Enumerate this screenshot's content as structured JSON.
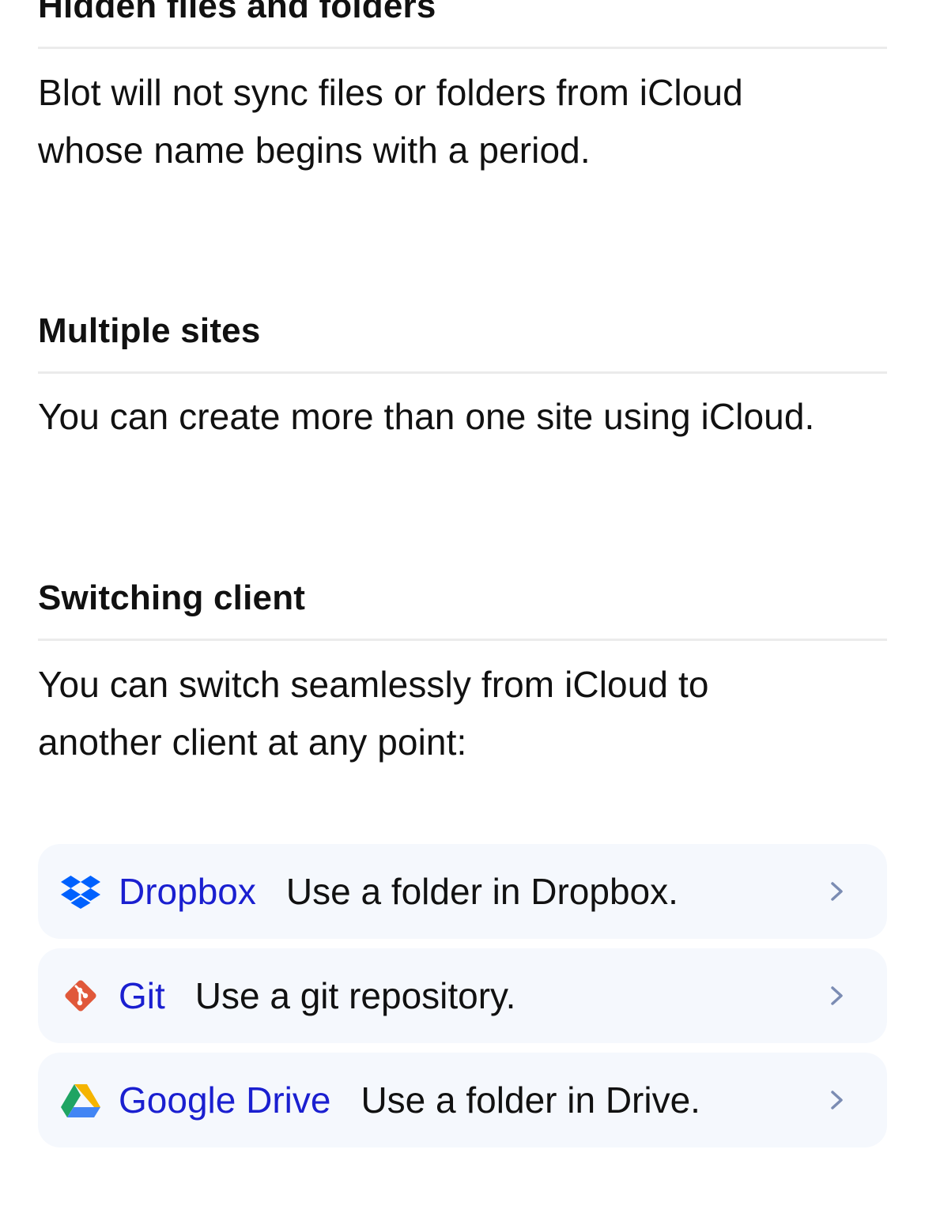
{
  "sections": [
    {
      "heading": "Hidden files and folders",
      "paragraph_lines": [
        "Blot will not sync files or folders from iCloud",
        "whose name begins with a period."
      ]
    },
    {
      "heading": "Multiple sites",
      "paragraph_lines": [
        "You can create more than one site using iCloud."
      ]
    },
    {
      "heading": "Switching client",
      "paragraph_lines": [
        "You can switch seamlessly from iCloud to",
        "another client at any point:"
      ]
    }
  ],
  "clients": [
    {
      "name": "Dropbox",
      "description": "Use a folder in Dropbox.",
      "icon": "dropbox-icon"
    },
    {
      "name": "Git",
      "description": "Use a git repository.",
      "icon": "git-icon"
    },
    {
      "name": "Google Drive",
      "description": "Use a folder in Drive.",
      "icon": "google-drive-icon"
    }
  ],
  "colors": {
    "link": "#1a1fd0",
    "card_background": "#f5f8fd",
    "rule": "#ebebeb",
    "dropbox": "#0061fe",
    "git": "#e0583a",
    "chevron": "#7b8cb3"
  }
}
